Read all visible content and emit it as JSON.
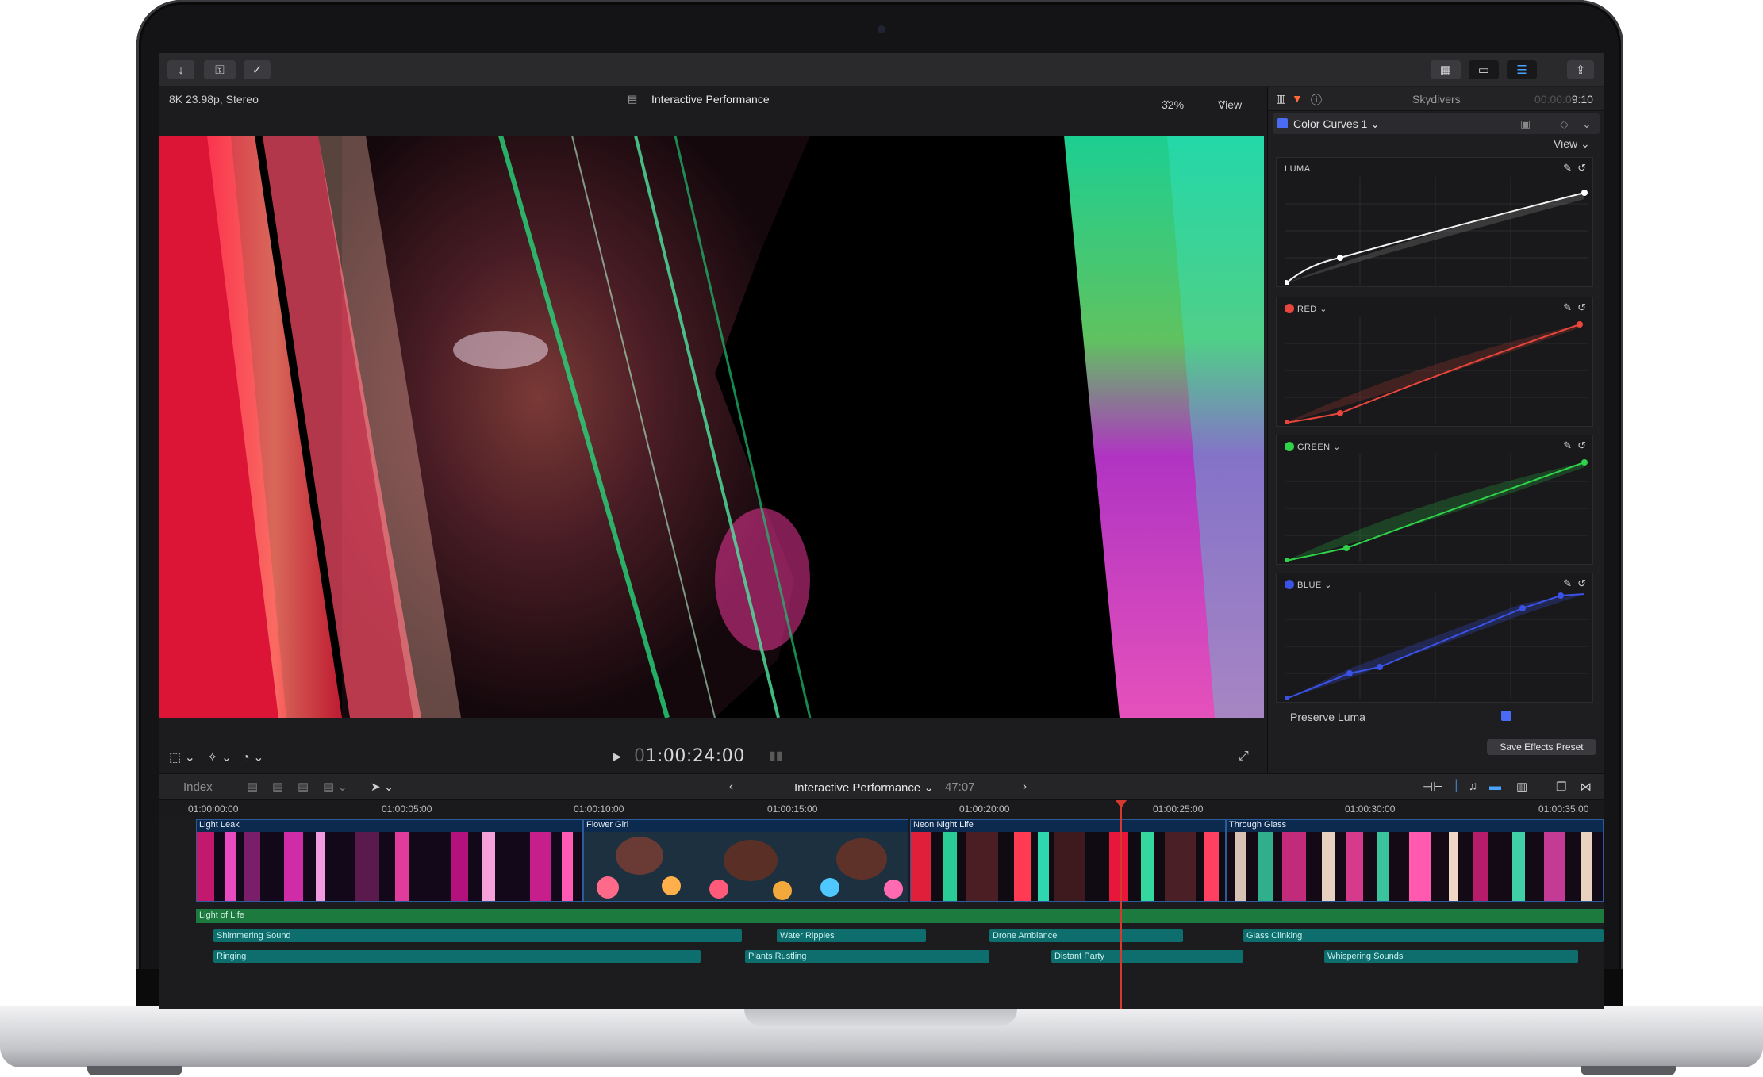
{
  "toolbar": {
    "import_icon": "↓",
    "keyword_icon": "⚿",
    "background_icon": "✓",
    "browser_icon": "▦",
    "timeline_icon": "▭",
    "inspector_icon": "☰",
    "share_icon": "⇪"
  },
  "viewer": {
    "format": "8K 23.98p, Stereo",
    "project_title": "Interactive Performance",
    "zoom": "32%",
    "view_label": "View",
    "timecode": "1:00:24:00",
    "timecode_prefix": "0"
  },
  "inspector": {
    "clip_name": "Skydivers",
    "duration": "9:10",
    "duration_prefix": "00:00:0",
    "effect_name": "Color Curves 1",
    "view_label": "View",
    "curves": [
      {
        "label": "LUMA",
        "color": "#f2f2f2"
      },
      {
        "label": "RED",
        "color": "#e8453c"
      },
      {
        "label": "GREEN",
        "color": "#2fd24a"
      },
      {
        "label": "BLUE",
        "color": "#3b52e6"
      }
    ],
    "preserve_luma": "Preserve Luma",
    "save_preset": "Save Effects Preset"
  },
  "timeline": {
    "index_label": "Index",
    "project_title": "Interactive Performance",
    "duration": "47:07",
    "ruler": [
      "01:00:00:00",
      "01:00:05:00",
      "01:00:10:00",
      "01:00:15:00",
      "01:00:20:00",
      "01:00:25:00",
      "01:00:30:00",
      "01:00:35:00"
    ],
    "clips": [
      "Light Leak",
      "Flower Girl",
      "Neon Night Life",
      "Through Glass"
    ],
    "music": "Light of Life",
    "audio_row1": [
      "Shimmering Sound",
      "Water Ripples",
      "Drone Ambiance",
      "Glass Clinking"
    ],
    "audio_row2": [
      "Ringing",
      "Plants Rustling",
      "Distant Party",
      "Whispering Sounds"
    ]
  }
}
